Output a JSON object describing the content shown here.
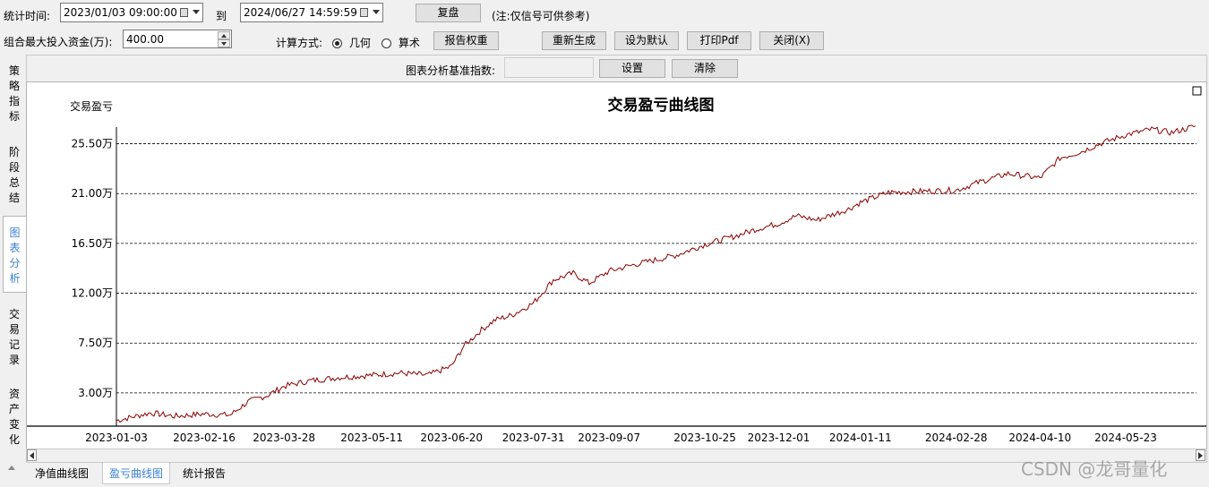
{
  "top_row": {
    "stat_time_label": "统计时间:",
    "start_datetime": "2023/01/03 09:00:00",
    "to_label": "到",
    "end_datetime": "2024/06/27 14:59:59",
    "replay_button": "复盘",
    "note": "(注:仅信号可供参考)"
  },
  "second_row": {
    "max_capital_label": "组合最大投入资金(万):",
    "max_capital_value": "400.00",
    "calc_method_label": "计算方式:",
    "radio_geometric": "几何",
    "radio_arithmetic": "算术",
    "selected_method": "geometric",
    "report_weight_button": "报告权重",
    "regenerate_button": "重新生成",
    "set_default_button": "设为默认",
    "print_pdf_button": "打印Pdf",
    "close_button": "关闭(X)"
  },
  "analysis_bar": {
    "baseline_label": "图表分析基准指数:",
    "baseline_value": "",
    "set_button": "设置",
    "clear_button": "清除"
  },
  "side_tabs": [
    {
      "label": "策略指标",
      "active": false
    },
    {
      "label": "阶段总结",
      "active": false
    },
    {
      "label": "图表分析",
      "active": true
    },
    {
      "label": "交易记录",
      "active": false
    },
    {
      "label": "资产变化",
      "active": false
    }
  ],
  "bottom_tabs": [
    {
      "label": "净值曲线图",
      "active": false
    },
    {
      "label": "盈亏曲线图",
      "active": true
    },
    {
      "label": "统计报告",
      "active": false
    }
  ],
  "watermark": "CSDN @龙哥量化",
  "colors": {
    "line": "#8b0000",
    "active_tab_text": "#3a7fd4",
    "grid": "#000000"
  },
  "chart_data": {
    "type": "line",
    "title": "交易盈亏曲线图",
    "ylabel": "交易盈亏",
    "ylim": [
      0,
      27
    ],
    "y_ticks": [
      3.0,
      7.5,
      12.0,
      16.5,
      21.0,
      25.5
    ],
    "y_tick_labels": [
      "3.00万",
      "7.50万",
      "12.00万",
      "16.50万",
      "21.00万",
      "25.50万"
    ],
    "y_unit": "万",
    "grid": "horizontal dashed",
    "x_tick_labels": [
      "2023-01-03",
      "2023-02-16",
      "2023-03-28",
      "2023-05-11",
      "2023-06-20",
      "2023-07-31",
      "2023-09-07",
      "2023-10-25",
      "2023-12-01",
      "2024-01-11",
      "2024-02-28",
      "2024-04-10",
      "2024-05-23"
    ],
    "series": [
      {
        "x": [
          "2023-01-03",
          "2023-01-20",
          "2023-02-01",
          "2023-02-16",
          "2023-03-01",
          "2023-03-10",
          "2023-03-20",
          "2023-03-28",
          "2023-04-10",
          "2023-04-25",
          "2023-05-11",
          "2023-05-25",
          "2023-06-08",
          "2023-06-20",
          "2023-06-26",
          "2023-07-05",
          "2023-07-12",
          "2023-07-20",
          "2023-07-31",
          "2023-08-10",
          "2023-08-20",
          "2023-08-28",
          "2023-09-07",
          "2023-09-20",
          "2023-10-10",
          "2023-10-25",
          "2023-11-10",
          "2023-11-20",
          "2023-12-01",
          "2023-12-10",
          "2023-12-20",
          "2024-01-05",
          "2024-01-11",
          "2024-01-25",
          "2024-02-10",
          "2024-02-28",
          "2024-03-10",
          "2024-03-25",
          "2024-04-10",
          "2024-04-20",
          "2024-05-01",
          "2024-05-10",
          "2024-05-23",
          "2024-06-05",
          "2024-06-15",
          "2024-06-27"
        ],
        "y": [
          0.5,
          1.2,
          0.9,
          1.1,
          1.0,
          2.2,
          2.8,
          3.6,
          4.1,
          4.4,
          4.6,
          4.8,
          4.6,
          5.4,
          7.2,
          8.7,
          9.6,
          10.0,
          11.1,
          13.2,
          13.8,
          12.9,
          14.0,
          14.6,
          15.4,
          16.4,
          17.2,
          17.8,
          18.3,
          19.0,
          18.6,
          19.6,
          20.2,
          21.1,
          21.2,
          21.3,
          22.0,
          22.8,
          22.4,
          24.2,
          24.8,
          25.5,
          26.3,
          26.8,
          26.5,
          27.1
        ]
      }
    ]
  }
}
